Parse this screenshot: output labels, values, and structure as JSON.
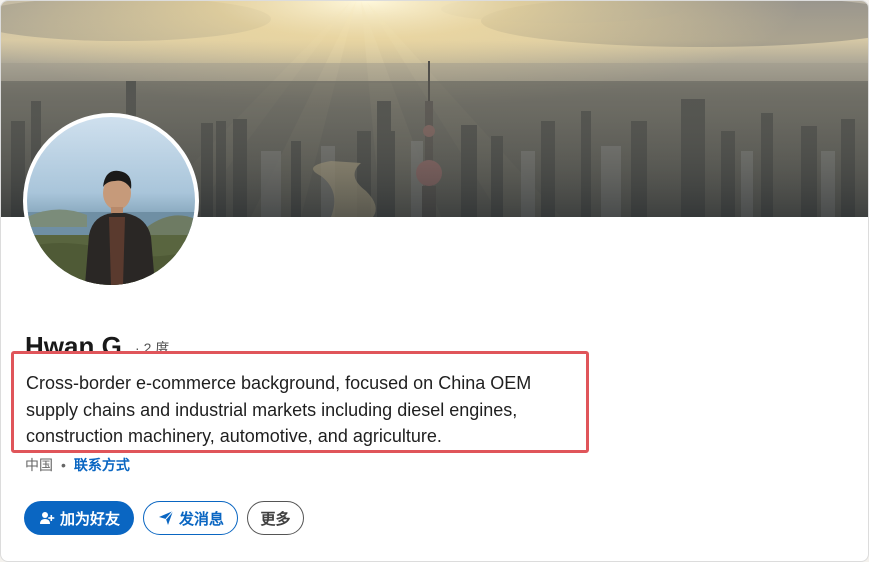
{
  "profile": {
    "name": "Hwan G.",
    "degree": "· 2 度",
    "headline": "Cross-border e-commerce background, focused on China OEM supply chains and industrial markets including diesel engines, construction machinery, automotive, and agriculture.",
    "location": "中国",
    "separator": "•",
    "contact_label": "联系方式"
  },
  "actions": {
    "connect_label": "加为好友",
    "message_label": "发消息",
    "more_label": "更多"
  },
  "colors": {
    "brand_blue": "#0a66c2",
    "highlight_red": "#e0555a"
  },
  "icons": {
    "connect": "add-person-icon",
    "message": "paper-plane-icon"
  }
}
